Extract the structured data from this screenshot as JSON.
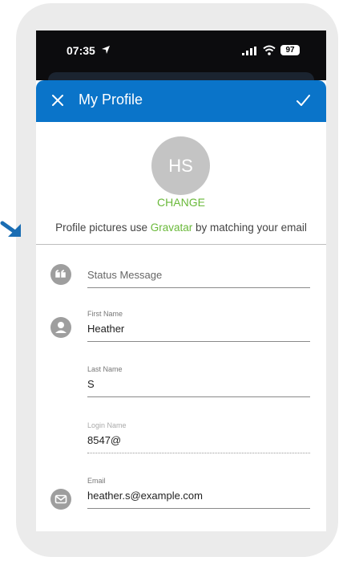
{
  "status_bar": {
    "time": "07:35",
    "battery": "97"
  },
  "header": {
    "title": "My Profile"
  },
  "avatar": {
    "initials": "HS"
  },
  "change_label": "CHANGE",
  "gravatar_note": {
    "prefix": "Profile pictures use ",
    "link": "Gravatar",
    "suffix": " by matching your email"
  },
  "fields": {
    "status": {
      "placeholder": "Status Message"
    },
    "first_name": {
      "label": "First Name",
      "value": "Heather"
    },
    "last_name": {
      "label": "Last Name",
      "value": "S"
    },
    "login_name": {
      "label": "Login Name",
      "value": "8547@"
    },
    "email": {
      "label": "Email",
      "value": "heather.s@example.com"
    }
  },
  "colors": {
    "header": "#0a74c9",
    "accent": "#6ab93a",
    "annotation_arrow": "#1a6db3"
  }
}
